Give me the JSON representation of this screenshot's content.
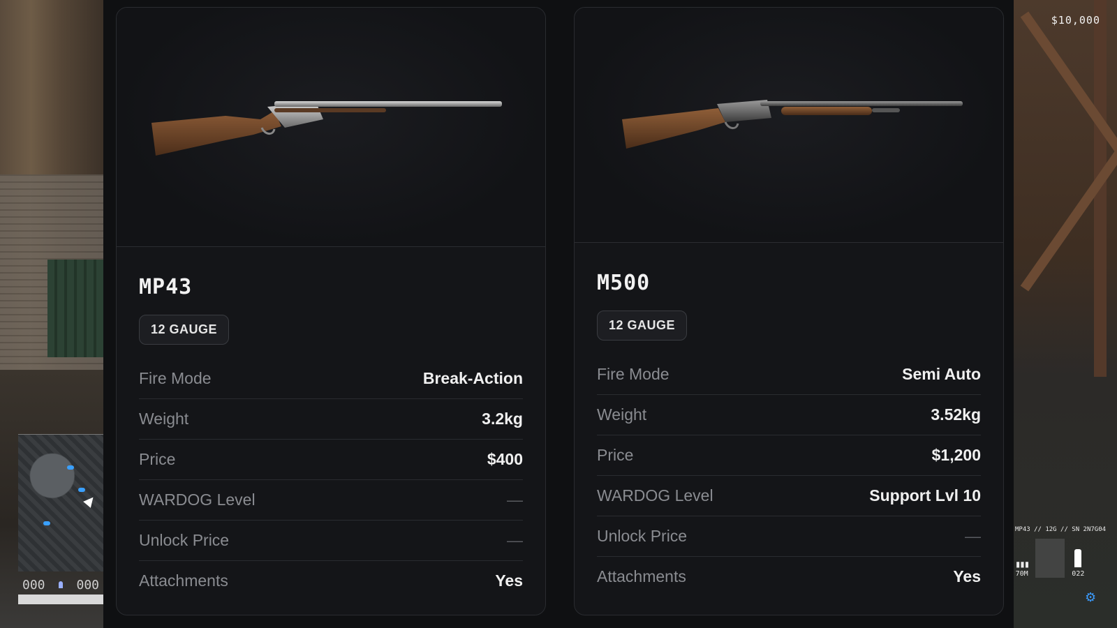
{
  "hud": {
    "money": "$10,000",
    "compass_left": "000",
    "compass_right": "000",
    "weapon_serial": "MP43 // 12G // SN 2N7G04",
    "reserve_ammo": "70M",
    "mag_ammo": "022"
  },
  "weapons": [
    {
      "name": "MP43",
      "caliber": "12 GAUGE",
      "stats": [
        {
          "label": "Fire Mode",
          "value": "Break-Action"
        },
        {
          "label": "Weight",
          "value": "3.2kg"
        },
        {
          "label": "Price",
          "value": "$400"
        },
        {
          "label": "WARDOG Level",
          "value": "—"
        },
        {
          "label": "Unlock Price",
          "value": "—"
        },
        {
          "label": "Attachments",
          "value": "Yes"
        }
      ]
    },
    {
      "name": "M500",
      "caliber": "12 GAUGE",
      "stats": [
        {
          "label": "Fire Mode",
          "value": "Semi Auto"
        },
        {
          "label": "Weight",
          "value": "3.52kg"
        },
        {
          "label": "Price",
          "value": "$1,200"
        },
        {
          "label": "WARDOG Level",
          "value": "Support Lvl 10"
        },
        {
          "label": "Unlock Price",
          "value": "—"
        },
        {
          "label": "Attachments",
          "value": "Yes"
        }
      ]
    }
  ],
  "colors": {
    "card_bg": "#141518",
    "label": "#8a8c91",
    "value": "#f0f0f0",
    "accent_blue": "#3b9cff"
  }
}
